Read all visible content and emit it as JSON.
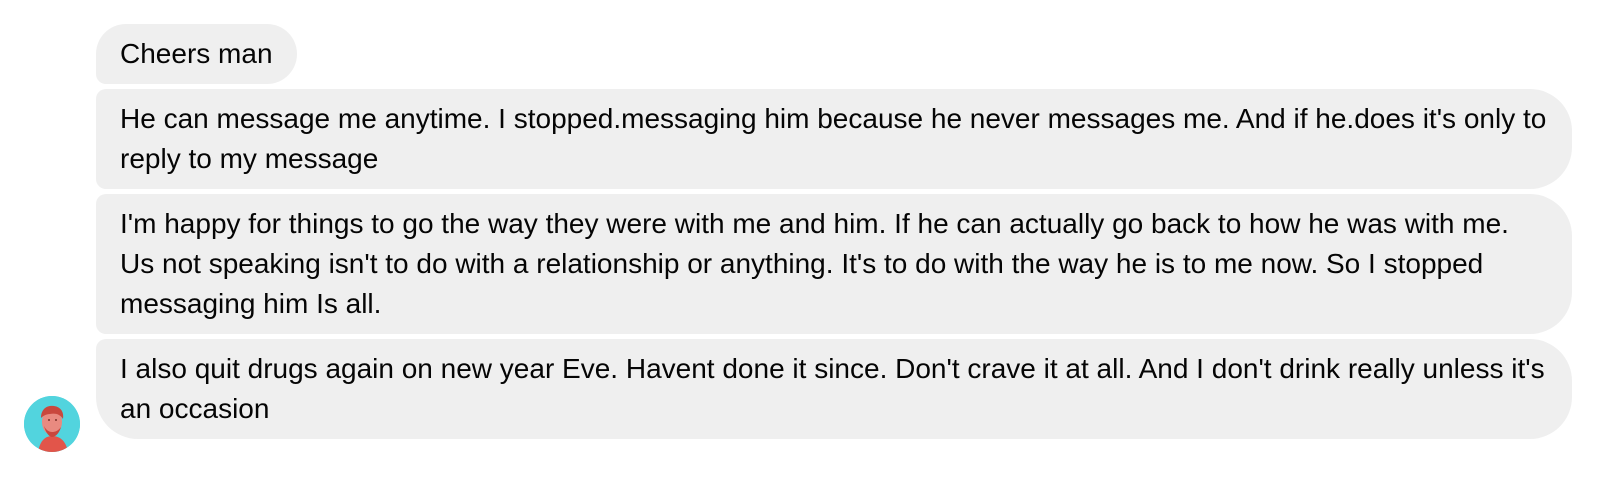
{
  "conversation": {
    "messages": [
      {
        "text": "Cheers man"
      },
      {
        "text": "He can message me anytime. I stopped.messaging him because he never messages me. And if he.does it's only to reply to my message"
      },
      {
        "text": "I'm happy for things to go the way they were with me and him. If he can actually go back to how he was with me. Us not speaking isn't to do with a relationship or anything. It's to do with the way he is to me now. So I stopped messaging him Is all."
      },
      {
        "text": "I also quit drugs again on new year Eve. Havent done it since. Don't crave it at all. And I don't drink really unless it's an occasion"
      }
    ],
    "sender": {
      "avatar_icon": "person-photo-icon"
    }
  },
  "colors": {
    "bubble_background": "#efefef",
    "text": "#050505",
    "avatar_background": "#52d4de",
    "avatar_figure": "#e2554a"
  }
}
